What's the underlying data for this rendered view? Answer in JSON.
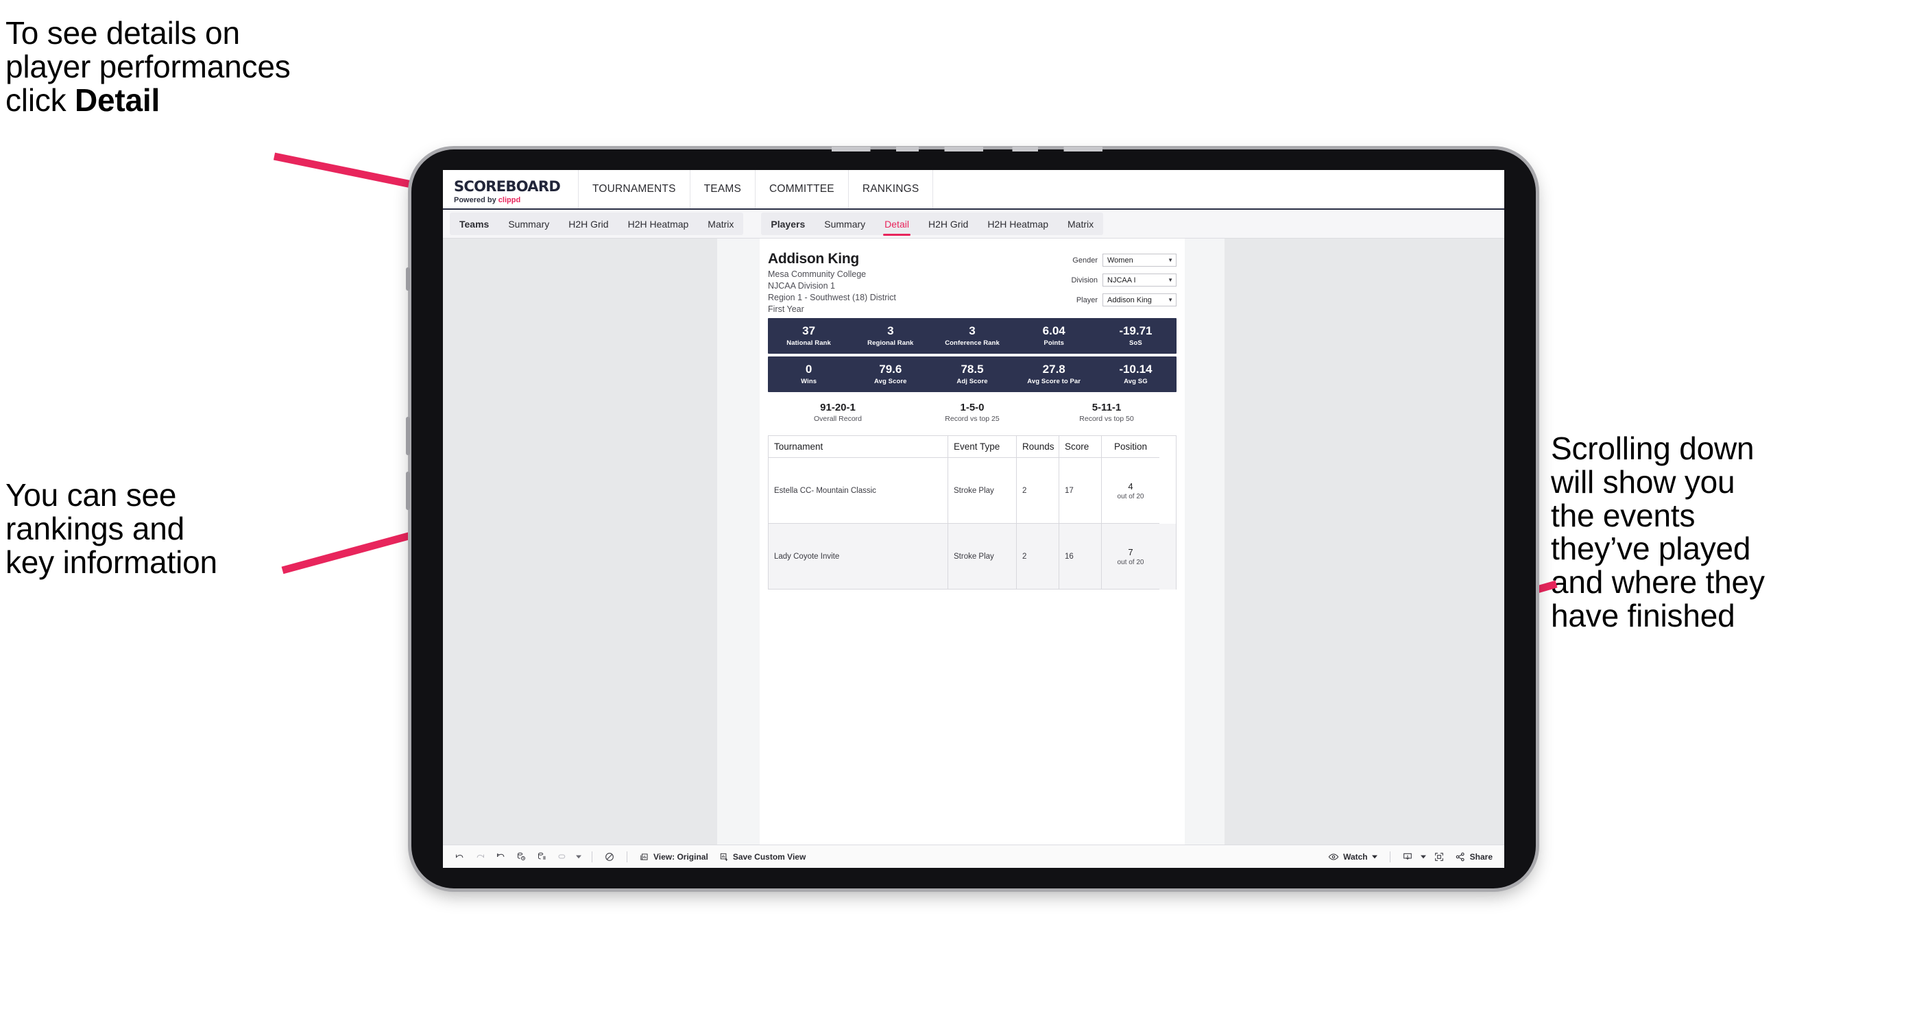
{
  "annotations": {
    "top_left": "To see details on\nplayer performances\nclick ",
    "top_left_bold": "Detail",
    "mid_left": "You can see\nrankings and\nkey information",
    "right": "Scrolling down\nwill show you\nthe events\nthey’ve played\nand where they\nhave finished",
    "arrow_color": "#e8255c"
  },
  "app": {
    "brand": {
      "title": "SCOREBOARD",
      "powered_prefix": "Powered by ",
      "powered_name": "clippd"
    },
    "top_nav": [
      "TOURNAMENTS",
      "TEAMS",
      "COMMITTEE",
      "RANKINGS"
    ],
    "tabs_teams": {
      "head": "Teams",
      "items": [
        "Summary",
        "H2H Grid",
        "H2H Heatmap",
        "Matrix"
      ]
    },
    "tabs_players": {
      "head": "Players",
      "items": [
        "Summary",
        "Detail",
        "H2H Grid",
        "H2H Heatmap",
        "Matrix"
      ],
      "active": "Detail"
    }
  },
  "player": {
    "name": "Addison King",
    "school": "Mesa Community College",
    "division": "NJCAA Division 1",
    "region": "Region 1 - Southwest (18) District",
    "year": "First Year"
  },
  "filters": [
    {
      "label": "Gender",
      "value": "Women"
    },
    {
      "label": "Division",
      "value": "NJCAA I"
    },
    {
      "label": "Player",
      "value": "Addison King"
    }
  ],
  "stats_band_1": [
    {
      "value": "37",
      "label": "National Rank"
    },
    {
      "value": "3",
      "label": "Regional Rank"
    },
    {
      "value": "3",
      "label": "Conference Rank"
    },
    {
      "value": "6.04",
      "label": "Points"
    },
    {
      "value": "-19.71",
      "label": "SoS"
    }
  ],
  "stats_band_2": [
    {
      "value": "0",
      "label": "Wins"
    },
    {
      "value": "79.6",
      "label": "Avg Score"
    },
    {
      "value": "78.5",
      "label": "Adj Score"
    },
    {
      "value": "27.8",
      "label": "Avg Score to Par"
    },
    {
      "value": "-10.14",
      "label": "Avg SG"
    }
  ],
  "records": [
    {
      "value": "91-20-1",
      "label": "Overall Record"
    },
    {
      "value": "1-5-0",
      "label": "Record vs top 25"
    },
    {
      "value": "5-11-1",
      "label": "Record vs top 50"
    }
  ],
  "table": {
    "headers": [
      "Tournament",
      "Event Type",
      "Rounds",
      "Score",
      "Position"
    ],
    "rows": [
      {
        "tournament": "Estella CC- Mountain Classic",
        "event_type": "Stroke Play",
        "rounds": "2",
        "score": "17",
        "position": "4",
        "position_of": "out of 20"
      },
      {
        "tournament": "Lady Coyote Invite",
        "event_type": "Stroke Play",
        "rounds": "2",
        "score": "16",
        "position": "7",
        "position_of": "out of 20"
      }
    ]
  },
  "toolbar": {
    "view_label": "View: Original",
    "save_label": "Save Custom View",
    "watch_label": "Watch",
    "share_label": "Share"
  }
}
